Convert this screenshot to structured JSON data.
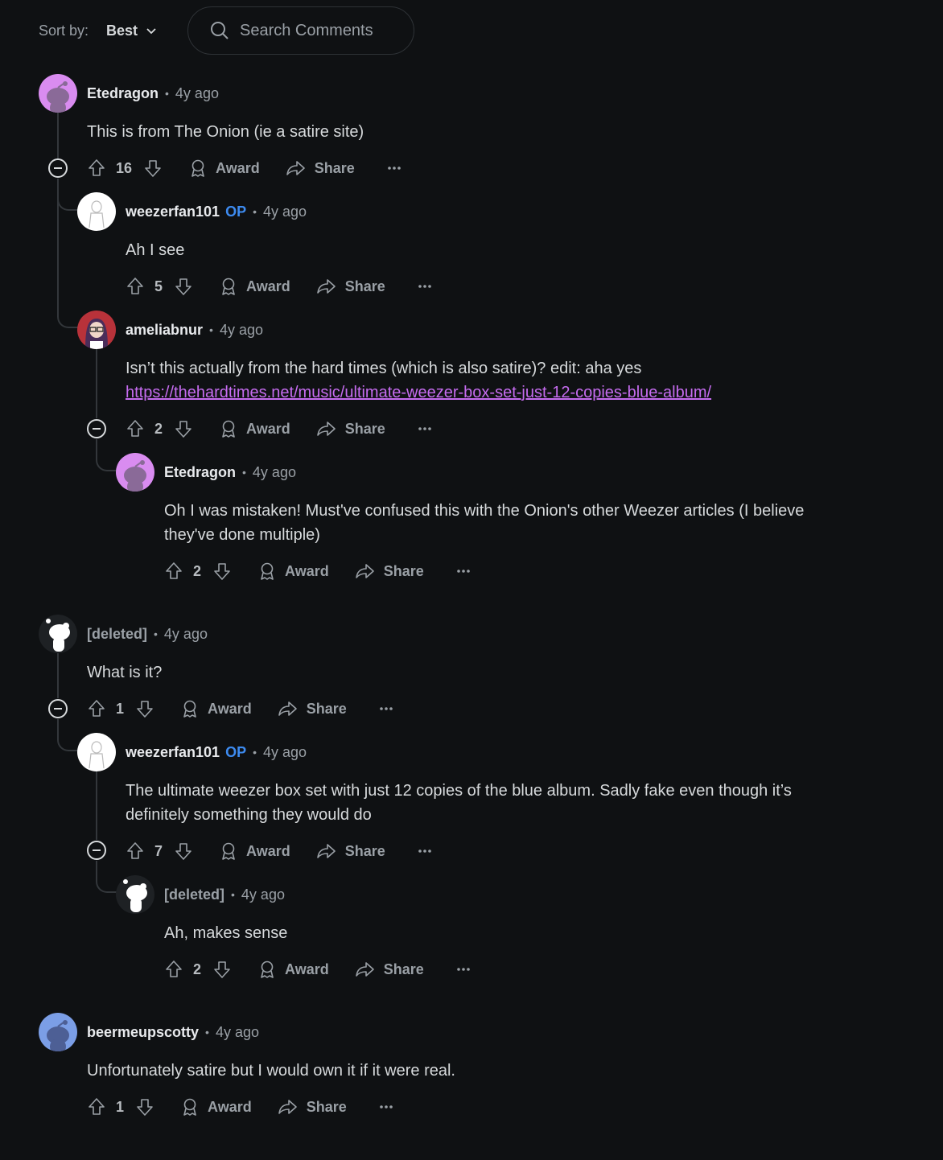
{
  "sort": {
    "label": "Sort by:",
    "value": "Best"
  },
  "search": {
    "placeholder": "Search Comments"
  },
  "actions": {
    "award": "Award",
    "share": "Share"
  },
  "comments": [
    {
      "user": "Etedragon",
      "op": "",
      "time": "4y ago",
      "text": "This is from The Onion (ie a satire site)",
      "score": "16"
    },
    {
      "user": "weezerfan101",
      "op": "OP",
      "time": "4y ago",
      "text": "Ah I see",
      "score": "5"
    },
    {
      "user": "ameliabnur",
      "op": "",
      "time": "4y ago",
      "text": "Isn’t this actually from the hard times (which is also satire)? edit: aha yes",
      "link": "https://thehardtimes.net/music/ultimate-weezer-box-set-just-12-copies-blue-album/",
      "score": "2"
    },
    {
      "user": "Etedragon",
      "op": "",
      "time": "4y ago",
      "text_line1": "Oh I was mistaken! Must've confused this with the Onion's other Weezer articles (I believe",
      "text_line2": "they've done multiple)",
      "score": "2"
    },
    {
      "user": "[deleted]",
      "op": "",
      "time": "4y ago",
      "text": "What is it?",
      "score": "1"
    },
    {
      "user": "weezerfan101",
      "op": "OP",
      "time": "4y ago",
      "text_line1": "The ultimate weezer box set with just 12 copies of the blue album. Sadly fake even though it’s",
      "text_line2": "definitely something they would do",
      "score": "7"
    },
    {
      "user": "[deleted]",
      "op": "",
      "time": "4y ago",
      "text": "Ah, makes sense",
      "score": "2"
    },
    {
      "user": "beermeupscotty",
      "op": "",
      "time": "4y ago",
      "text": "Unfortunately satire but I would own it if it were real.",
      "score": "1"
    }
  ],
  "colors": {
    "background": "#0f1113",
    "op": "#3d8bf0",
    "link": "#c66cf0"
  }
}
